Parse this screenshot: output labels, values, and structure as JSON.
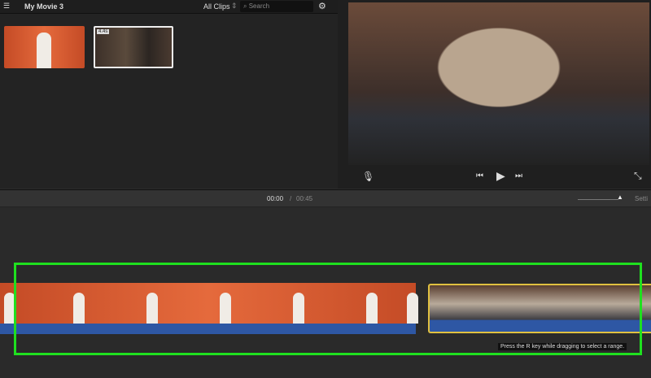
{
  "header": {
    "project_title": "My Movie 3",
    "filter_label": "All Clips",
    "search_placeholder": "Search"
  },
  "browser": {
    "clips": [
      {
        "name": "orange-background-clip"
      },
      {
        "name": "office-clip",
        "badge": "4.4s"
      }
    ]
  },
  "viewer": {
    "controls": [
      "microphone",
      "skip-back",
      "play",
      "skip-forward",
      "fullscreen"
    ]
  },
  "timebar": {
    "current_time": "00:00",
    "separator": "/",
    "total_time": "00:45",
    "settings_label": "Setti"
  },
  "timeline": {
    "tooltip": "Press the R key while dragging to select a range.",
    "colors": {
      "highlight": "#1fe01f",
      "audio": "#2e57a4",
      "selection": "#e0c040"
    }
  }
}
